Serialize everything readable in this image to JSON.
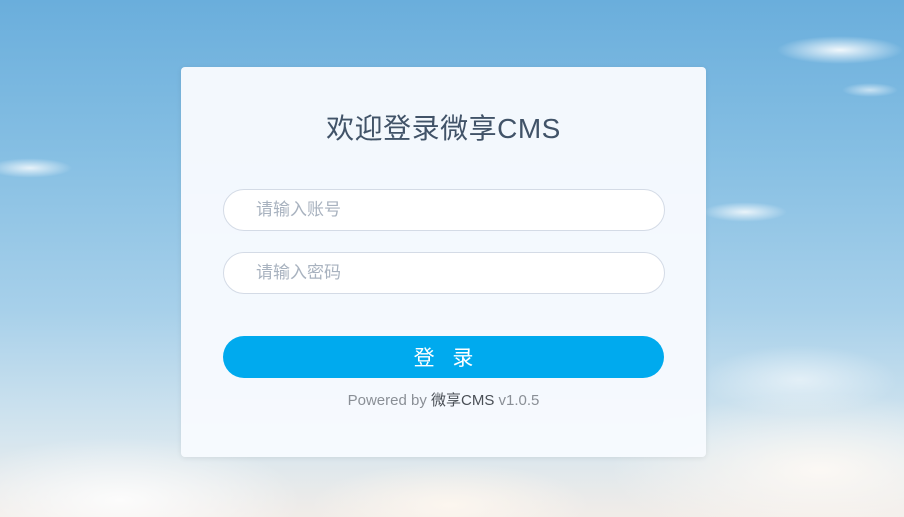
{
  "login": {
    "title": "欢迎登录微享CMS",
    "username_placeholder": "请输入账号",
    "password_placeholder": "请输入密码",
    "submit_label": "登 录",
    "footer": {
      "prefix": "Powered by ",
      "brand": "微享CMS",
      "version": " v1.0.5"
    }
  },
  "colors": {
    "button": "#00aaee",
    "title": "#415368"
  }
}
